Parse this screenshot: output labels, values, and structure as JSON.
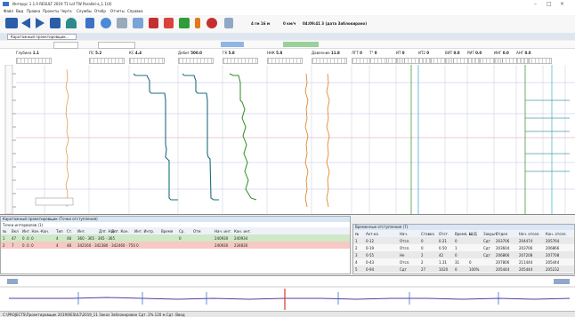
{
  "window": {
    "title": "Интерус 1.1.0 RESULT 2019 T1 Lof TW Parallel-a_1.1(0)"
  },
  "menu": [
    "Файл",
    "Вид",
    "Правка",
    "Проекты",
    "Черта",
    "Службы",
    "Отобр",
    "Отчеты",
    "Справка"
  ],
  "toolbar": {
    "depth_label": "4 гм 16 м",
    "speed_label": "0 км/ч",
    "time_label": "04:09:41  3 (дата Заблокирано)"
  },
  "doc_tab": "Каротажный проектировщик...",
  "tracks": [
    {
      "name": "Глубина",
      "value": "1.1"
    },
    {
      "name": "ПС",
      "value": "5.2"
    },
    {
      "name": "КС",
      "value": "4.4"
    },
    {
      "name": "Дебит",
      "value": "500.0"
    },
    {
      "name": "ГК",
      "value": "5.8"
    },
    {
      "name": "ННК",
      "value": "5.8"
    },
    {
      "name": "Давление",
      "value": "11.8"
    },
    {
      "name": "ЛГТ",
      "value": "0"
    },
    {
      "name": "Т°",
      "value": "0"
    },
    {
      "name": "ИТ",
      "value": "0"
    },
    {
      "name": "ИТ2",
      "value": "0"
    },
    {
      "name": "ВИТ",
      "value": "0.0"
    },
    {
      "name": "РИТ",
      "value": "0.0"
    },
    {
      "name": "ИНГ",
      "value": "0.0"
    },
    {
      "name": "АНГ",
      "value": "0.0"
    }
  ],
  "left_panel": {
    "title": "Каротажный проектировщик (Точки отступления)",
    "subtitle": "Точки интервалов (1)",
    "columns": [
      "№",
      "Вкл",
      "Инт. Нач.-Кон.",
      "Тип",
      "Ст.",
      "Инт.",
      "Длт. Нач.",
      "Длт. Кон.",
      "Инт. Интр.",
      "Время",
      "Ср.",
      "Отм",
      "Нач. инт.",
      "Кон. инт."
    ],
    "rows": [
      [
        "1",
        "47",
        "0 .0 .0",
        "4",
        "48",
        "360 · 365 · 365 · 365",
        "0",
        "",
        "240930",
        "240934"
      ],
      [
        "2",
        "7",
        "0 .0 .0",
        "4",
        "48",
        "342160 · 342380 · 342460 · 750 0",
        "",
        "",
        "240930",
        "234830"
      ]
    ]
  },
  "right_panel": {
    "title": "Временные отступления (7)",
    "columns": [
      "№",
      "Акт-ка",
      "Нач.",
      "Ставка",
      "Отст.",
      "Время, м",
      "Ш/Д",
      "Закрыт",
      "Отдел",
      "Нач. отсел.",
      "Кон. отсел."
    ],
    "rows": [
      [
        "1",
        "0-12",
        "Отсл.",
        "0",
        "0.21",
        "0",
        "",
        "Сдт",
        "203706",
        "204474",
        "205764"
      ],
      [
        "2",
        "0-19",
        "Отсл.",
        "0",
        "0.50",
        "1",
        "",
        "Сдт",
        "203604",
        "203706",
        "206866"
      ],
      [
        "3",
        "0-55",
        "Не",
        "2",
        "42",
        "0",
        "",
        "Сдт",
        "206866",
        "207208",
        "207708"
      ],
      [
        "4",
        "0-43",
        "Отсл.",
        "2",
        "1.31",
        "31",
        "0",
        "",
        "207806",
        "211444",
        "205444"
      ],
      [
        "5",
        "0-94",
        "Сдт",
        "27",
        "1020",
        "0",
        "100%",
        "",
        "205444",
        "205444",
        "205232"
      ]
    ]
  },
  "cross_section": {
    "markers": [
      "4",
      "8",
      "8",
      "8",
      "8",
      "8"
    ]
  },
  "status": {
    "text": "C:\\PROJECTS\\Проектировщик 2019\\RESULT\\2019_11 Заказ Заблокирован Сдт. 2% 120 м  Сдт. Ввод"
  },
  "colors": {
    "accent": "#2a5ea8",
    "ps_curve": "#1b6f7c",
    "gk_curve": "#2e8b1e",
    "nnk_curve": "#e07b1a",
    "row_green": "#cfe9c8",
    "row_red": "#f6c9c2"
  }
}
